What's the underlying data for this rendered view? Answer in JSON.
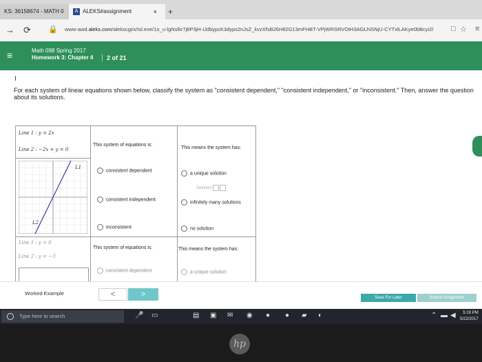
{
  "browser": {
    "tab1_label": "KS: 36158674 - MATH 0",
    "tab2_logo": "A",
    "tab2_label": "ALEKS#assignment",
    "tab2_close": "×",
    "new_tab": "+",
    "back_icon": "→",
    "refresh_icon": "⟳",
    "lock_icon": "🔒",
    "url_prefix": "www-awd.",
    "url_domain": "aleks.com",
    "url_path": "/alekscgi/x/Isl.exe/1o_u-lgNslkr7j8P3jH-IJdbypcK3dyps2nJsZ_kvzXfsB26H82G13mFHBT-VPjWRSRVOtH3AGLNSNjU-CYTxlLAKye0bBcyi2l",
    "bookmark_icon": "☆",
    "reader_icon": "□",
    "menu_icon": "≡"
  },
  "aleks_header": {
    "menu_icon": "≡",
    "course": "Math 098 Spring 2017",
    "homework": "Homework 3: Chapter 4",
    "count": "2 of 21",
    "accent": "#2e8f5a"
  },
  "question": {
    "cursor": "I",
    "instructions": "For each system of linear equations shown below, classify the system as \"consistent dependent,\" \"consistent independent,\" or \"inconsistent.\" Then, answer the question about its solutions."
  },
  "system1": {
    "line1": "Line 1 : y = 2x",
    "line2": "Line 2 : −2x + y = 0",
    "graph_label_top": "L1",
    "graph_label_bottom": "L2",
    "col2_header": "This system of equations is:",
    "col3_header": "This means the system has:",
    "options": [
      "consistent dependent",
      "consistent independent",
      "inconsistent"
    ],
    "solutions": [
      "a unique solution",
      "infinitely many solutions",
      "no solution"
    ],
    "solution_label": "Solution:"
  },
  "system2": {
    "line1": "Line 1 : y = 0",
    "line2": "Line 2 : y = −3",
    "col2_header": "This system of equations is:",
    "col3_header": "This means the system has:",
    "option1": "consistent dependent",
    "solution1": "a unique solution"
  },
  "bottom": {
    "worked_example": "Worked Example",
    "prev_icon": "<",
    "next_icon": ">",
    "save": "Save For Later",
    "submit": "Submit Assignment"
  },
  "taskbar": {
    "search_placeholder": "Type here to search",
    "time": "5:19 PM",
    "date": "5/22/2017"
  },
  "laptop": {
    "logo": "hp"
  }
}
